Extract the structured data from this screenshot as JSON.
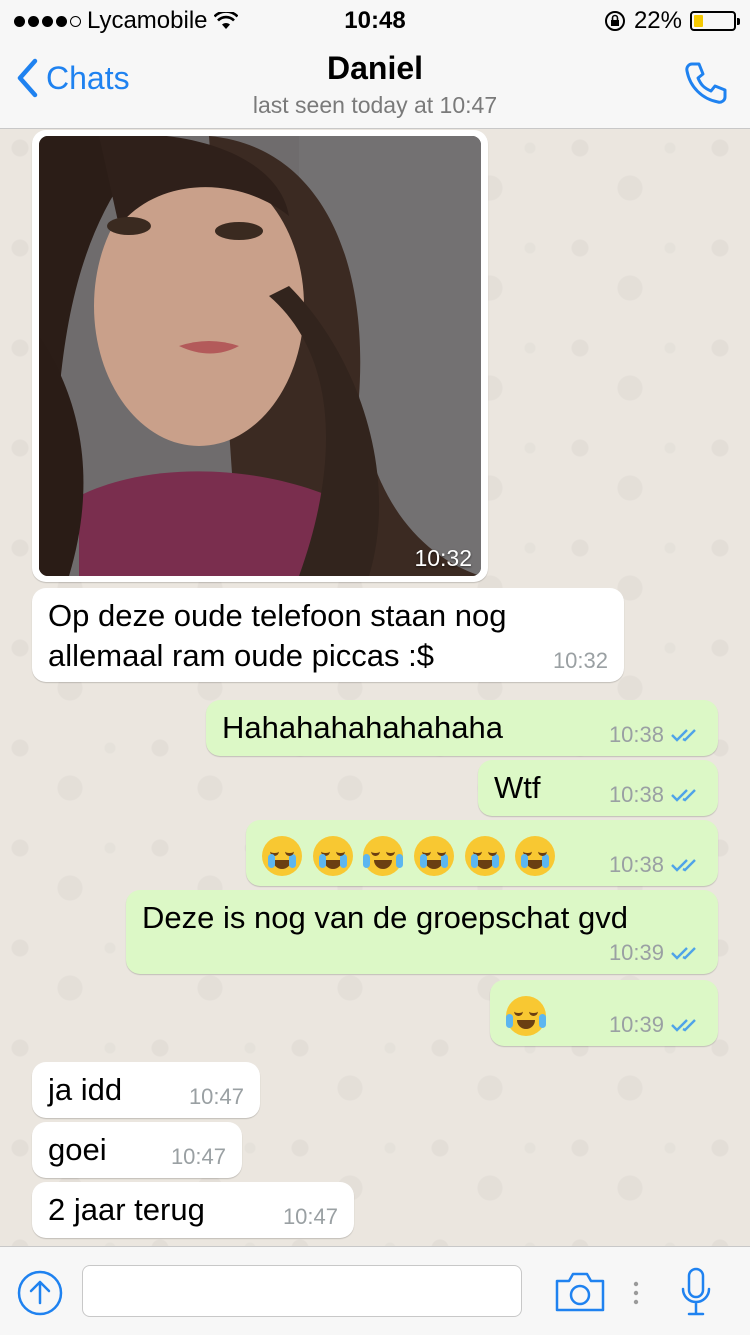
{
  "status_bar": {
    "carrier": "Lycamobile",
    "time": "10:48",
    "battery": "22%"
  },
  "header": {
    "back_label": "Chats",
    "title": "Daniel",
    "subtitle": "last seen today at 10:47"
  },
  "messages": [
    {
      "type": "photo",
      "direction": "incoming",
      "time": "10:32"
    },
    {
      "type": "text",
      "direction": "incoming",
      "lines": [
        "Op deze oude telefoon staan nog",
        "allemaal ram oude piccas :$"
      ],
      "time": "10:32"
    },
    {
      "type": "text",
      "direction": "outgoing",
      "text": "Hahahahahahahaha",
      "time": "10:38",
      "status": "read"
    },
    {
      "type": "text",
      "direction": "outgoing",
      "text": "Wtf",
      "time": "10:38",
      "status": "read"
    },
    {
      "type": "emoji",
      "direction": "outgoing",
      "emojis": [
        "loudly-crying-face",
        "loudly-crying-face",
        "tears-of-joy-face",
        "loudly-crying-face",
        "loudly-crying-face",
        "loudly-crying-face"
      ],
      "time": "10:38",
      "status": "read"
    },
    {
      "type": "text",
      "direction": "outgoing",
      "text": "Deze is nog van de groepschat gvd",
      "time": "10:39",
      "status": "read"
    },
    {
      "type": "emoji",
      "direction": "outgoing",
      "emojis": [
        "tears-of-joy-face"
      ],
      "time": "10:39",
      "status": "read"
    },
    {
      "type": "text",
      "direction": "incoming",
      "text": "ja idd",
      "time": "10:47"
    },
    {
      "type": "text",
      "direction": "incoming",
      "text": "goei",
      "time": "10:47"
    },
    {
      "type": "text",
      "direction": "incoming",
      "text": "2 jaar terug",
      "time": "10:47"
    }
  ],
  "input_bar": {
    "attach_icon": "upload-arrow-icon",
    "camera_icon": "camera-icon",
    "mic_icon": "microphone-icon",
    "message_value": ""
  },
  "colors": {
    "accent": "#1f82f0",
    "outgoing_bubble": "#dcf8c6",
    "incoming_bubble": "#ffffff",
    "read_ticks": "#4fa3e8"
  }
}
